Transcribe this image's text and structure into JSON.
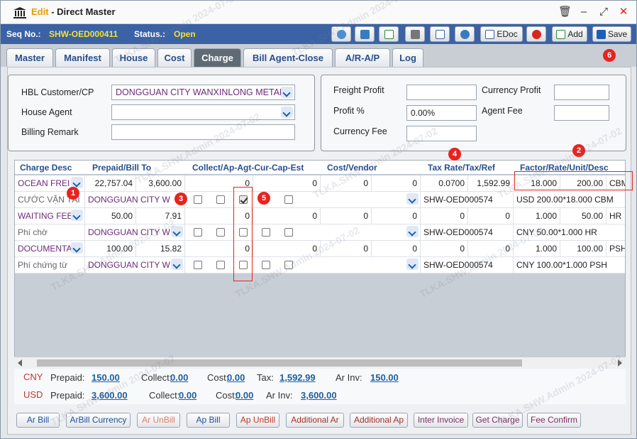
{
  "window": {
    "mode_label": "Edit",
    "title": "Direct Master"
  },
  "seq": {
    "label": "Seq No.:",
    "value": "SHW-OED000411",
    "status_label": "Status.:",
    "status_value": "Open"
  },
  "toolbar": {
    "edoc": "EDoc",
    "add": "Add",
    "save": "Save"
  },
  "tabs": [
    "Master",
    "Manifest",
    "House",
    "Cost",
    "Charge",
    "Bill Agent-Close",
    "A/R-A/P",
    "Log"
  ],
  "form": {
    "hbl_customer_label": "HBL Customer/CP",
    "hbl_customer_value": "DONGGUAN CITY WANXINLONG METAL",
    "house_agent_label": "House Agent",
    "house_agent_value": "",
    "billing_remark_label": "Billing Remark",
    "billing_remark_value": "",
    "freight_profit_label": "Freight Profit",
    "freight_profit_value": "",
    "profit_pct_label": "Profit %",
    "profit_pct_value": "0.00%",
    "currency_fee_label": "Currency Fee",
    "currency_fee_value": "",
    "currency_profit_label": "Currency Profit",
    "currency_profit_value": "",
    "agent_fee_label": "Agent Fee",
    "agent_fee_value": ""
  },
  "grid": {
    "headers": [
      "Charge Desc",
      "Prepaid/Bill To",
      "Collect/Ap-Agt-Cur-Cap-Est",
      "Cost/Vendor",
      "Tax Rate/Tax/Ref",
      "Factor/Rate/Unit/Desc"
    ],
    "rows": [
      {
        "desc": "OCEAN FREI",
        "prepaid": "22,757.04",
        "bill": "3,600.00",
        "collect": "0",
        "collect2": "0",
        "cost": "0",
        "vendor": "0",
        "taxrate": "0.0700",
        "tax": "1,592.99",
        "factor": "18.000",
        "rate": "200.00",
        "unit": "CBM"
      },
      {
        "desc": "CƯỚC VẬN TẢI",
        "billto": "DONGGUAN CITY W",
        "ref": "SHW-OED000574",
        "descr": "USD 200.00*18.000 CBM"
      },
      {
        "desc": "WAITING FEE",
        "prepaid": "50.00",
        "bill": "7.91",
        "collect": "0",
        "collect2": "0",
        "cost": "0",
        "vendor": "0",
        "taxrate": "0",
        "tax": "0",
        "factor": "1.000",
        "rate": "50.00",
        "unit": "HR"
      },
      {
        "desc": "Phí chờ",
        "billto": "DONGGUAN CITY W",
        "ref": "SHW-OED000574",
        "descr": "CNY 50.00*1.000 HR"
      },
      {
        "desc": "DOCUMENTA",
        "prepaid": "100.00",
        "bill": "15.82",
        "collect": "0",
        "collect2": "0",
        "cost": "0",
        "vendor": "0",
        "taxrate": "0",
        "tax": "0",
        "factor": "1.000",
        "rate": "100.00",
        "unit": "PSH"
      },
      {
        "desc": "Phí chứng từ",
        "billto": "DONGGUAN CITY W",
        "ref": "SHW-OED000574",
        "descr": "CNY 100.00*1.000 PSH"
      }
    ]
  },
  "totals": {
    "cny": {
      "cur": "CNY",
      "prepaid_l": "Prepaid:",
      "prepaid": "150.00",
      "collect_l": "Collect:",
      "collect": "0.00",
      "cost_l": "Cost:",
      "cost": "0.00",
      "tax_l": "Tax:",
      "tax": "1,592.99",
      "arinv_l": "Ar Inv:",
      "arinv": "150.00"
    },
    "usd": {
      "cur": "USD",
      "prepaid_l": "Prepaid:",
      "prepaid": "3,600.00",
      "collect_l": "Collect:",
      "collect": "0.00",
      "cost_l": "Cost:",
      "cost": "0.00",
      "arinv_l": "Ar Inv:",
      "arinv": "3,600.00"
    }
  },
  "buttons": [
    "Ar Bill",
    "ArBill Currency",
    "Ar UnBill",
    "Ap Bill",
    "Ap UnBill",
    "Additional Ar",
    "Additional Ap",
    "Inter Invoice",
    "Get Charge",
    "Fee Confirm"
  ],
  "badges": [
    "1",
    "2",
    "3",
    "4",
    "5",
    "6"
  ],
  "watermark": "TLKA.SHW.Admin 2024-07-02",
  "colors": {
    "header_blue": "#3a62a5",
    "status_yellow": "#f6e02c",
    "badge_red": "#e8231f",
    "link_blue": "#1b5fa3"
  }
}
